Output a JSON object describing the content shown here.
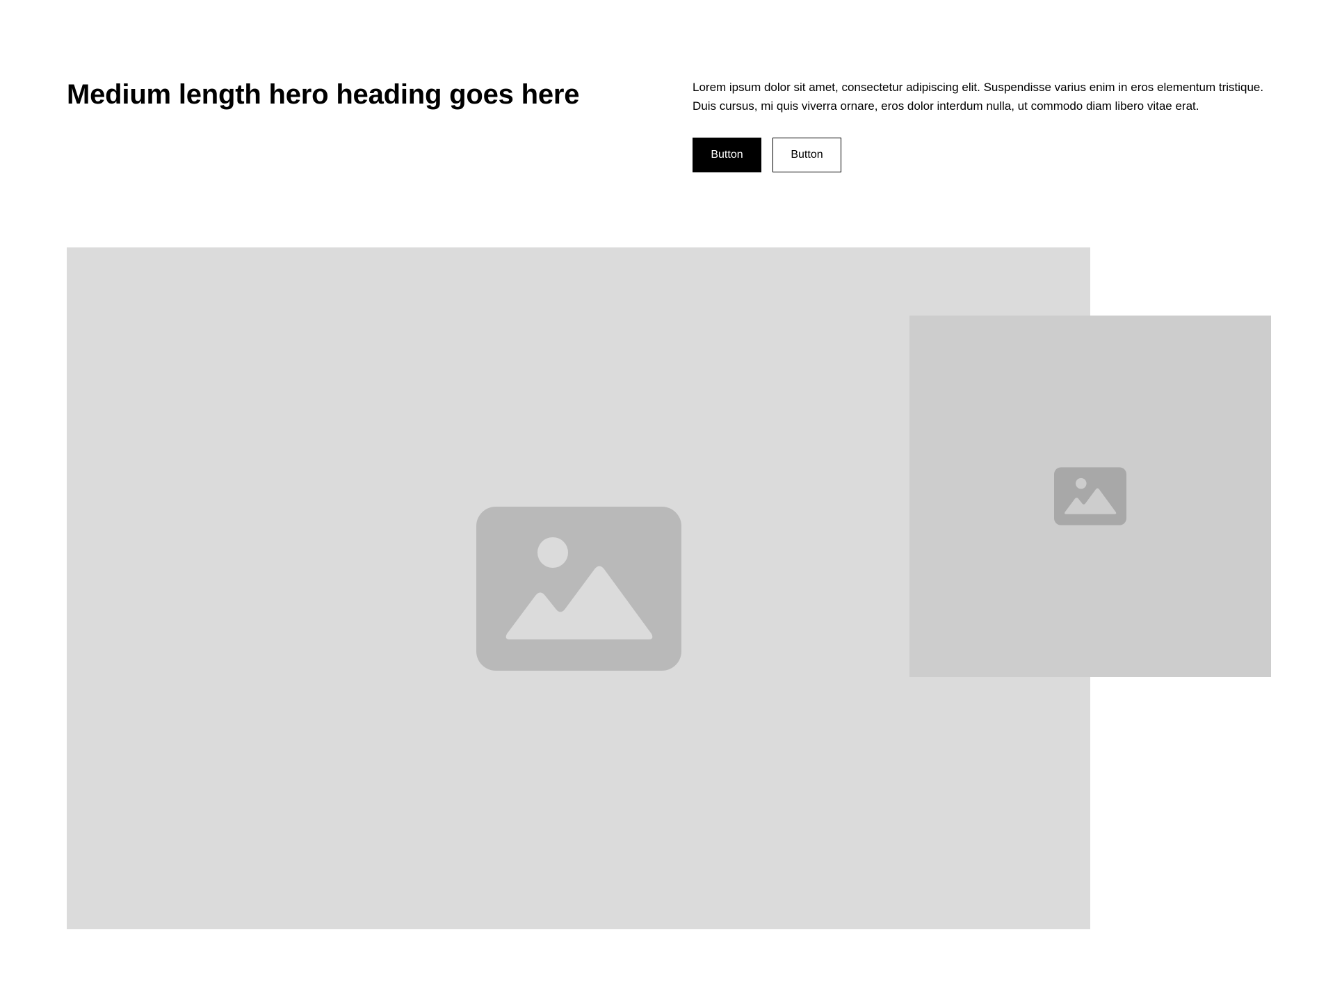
{
  "hero": {
    "heading": "Medium length hero heading goes here",
    "paragraph": "Lorem ipsum dolor sit amet, consectetur adipiscing elit. Suspendisse varius enim in eros elementum tristique. Duis cursus, mi quis viverra ornare, eros dolor interdum nulla, ut commodo diam libero vitae erat.",
    "primary_button_label": "Button",
    "secondary_button_label": "Button"
  },
  "images": {
    "main": {
      "icon": "image-placeholder-icon"
    },
    "secondary": {
      "icon": "image-placeholder-icon"
    }
  },
  "colors": {
    "primary_button_bg": "#000000",
    "main_placeholder_bg": "#dbdbdb",
    "secondary_placeholder_bg": "#cdcdcd",
    "main_icon": "#b9b9b9",
    "secondary_icon": "#a8a8a8"
  }
}
